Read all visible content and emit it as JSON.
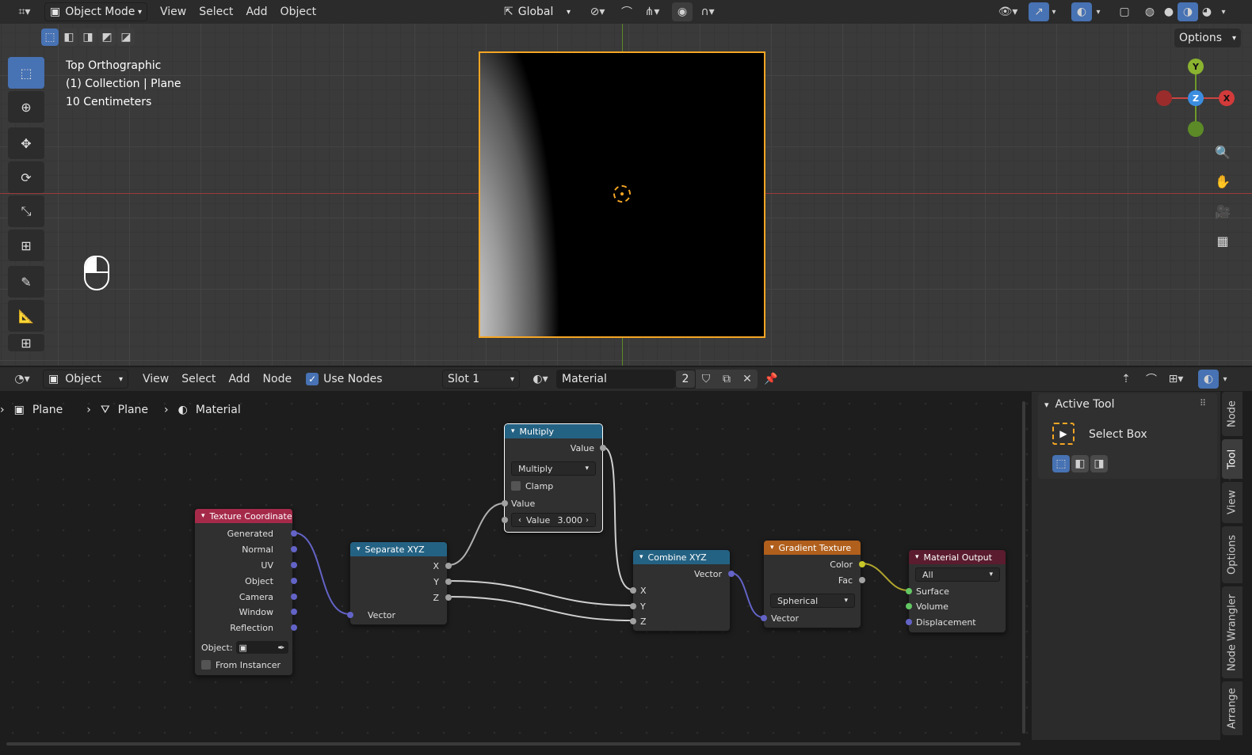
{
  "viewport_header": {
    "mode": "Object Mode",
    "menus": [
      "View",
      "Select",
      "Add",
      "Object"
    ],
    "orientation": "Global",
    "options": "Options"
  },
  "viewport_overlay": {
    "view_name": "Top Orthographic",
    "collection": "(1) Collection | Plane",
    "scale": "10 Centimeters"
  },
  "gizmo": {
    "y": "Y",
    "z": "Z",
    "x": "X"
  },
  "node_header": {
    "editor_type": "Object",
    "menus": [
      "View",
      "Select",
      "Add",
      "Node"
    ],
    "use_nodes": "Use Nodes",
    "slot": "Slot 1",
    "material": "Material",
    "users": "2"
  },
  "breadcrumb": {
    "object": "Plane",
    "mesh": "Plane",
    "material": "Material"
  },
  "nodes": {
    "texcoord": {
      "title": "Texture Coordinate",
      "outputs": [
        "Generated",
        "Normal",
        "UV",
        "Object",
        "Camera",
        "Window",
        "Reflection"
      ],
      "object_label": "Object:",
      "from_instancer": "From Instancer"
    },
    "separate": {
      "title": "Separate XYZ",
      "outputs": [
        "X",
        "Y",
        "Z"
      ],
      "input": "Vector"
    },
    "multiply": {
      "title": "Multiply",
      "output": "Value",
      "operation": "Multiply",
      "clamp": "Clamp",
      "input1": "Value",
      "input2_label": "Value",
      "input2_value": "3.000"
    },
    "combine": {
      "title": "Combine XYZ",
      "output": "Vector",
      "inputs": [
        "X",
        "Y",
        "Z"
      ]
    },
    "gradient": {
      "title": "Gradient Texture",
      "outputs": [
        "Color",
        "Fac"
      ],
      "type": "Spherical",
      "input": "Vector"
    },
    "output": {
      "title": "Material Output",
      "target": "All",
      "inputs": [
        "Surface",
        "Volume",
        "Displacement"
      ]
    }
  },
  "sidebar": {
    "section": "Active Tool",
    "tool_name": "Select Box"
  },
  "tabs": [
    "Node",
    "Tool",
    "View",
    "Options",
    "Node Wrangler",
    "Arrange"
  ],
  "colors": {
    "accent": "#4772b3",
    "selection": "#f5a623",
    "texcoord_header": "#a52a4a",
    "converter_header": "#246283",
    "texture_header": "#b05f1c",
    "output_header": "#5a1c2e"
  }
}
